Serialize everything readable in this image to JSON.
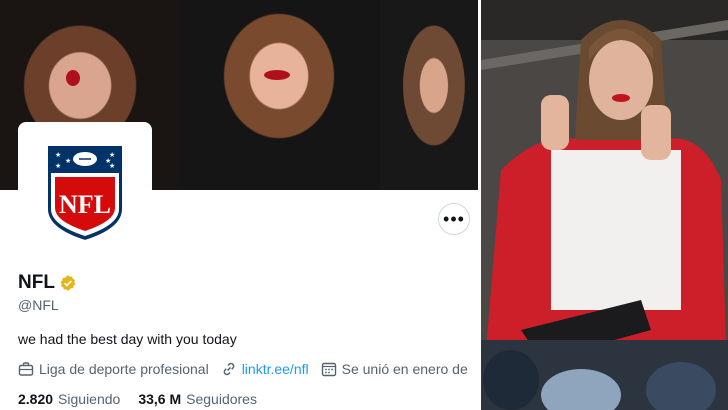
{
  "profile": {
    "name": "NFL",
    "handle": "@NFL",
    "bio": "we had the best day with you today",
    "category": "Liga de deporte profesional",
    "link": "linktr.ee/nfl",
    "joined": "Se unió en enero de",
    "following_count": "2.820",
    "following_label": "Siguiendo",
    "followers_count": "33,6 M",
    "followers_label": "Seguidores",
    "more_label": "•••"
  },
  "logo_text": "NFL",
  "colors": {
    "accent": "#1d9bf0",
    "verified": "#e2b719",
    "nfl_blue": "#013369",
    "nfl_red": "#d50a0a"
  }
}
